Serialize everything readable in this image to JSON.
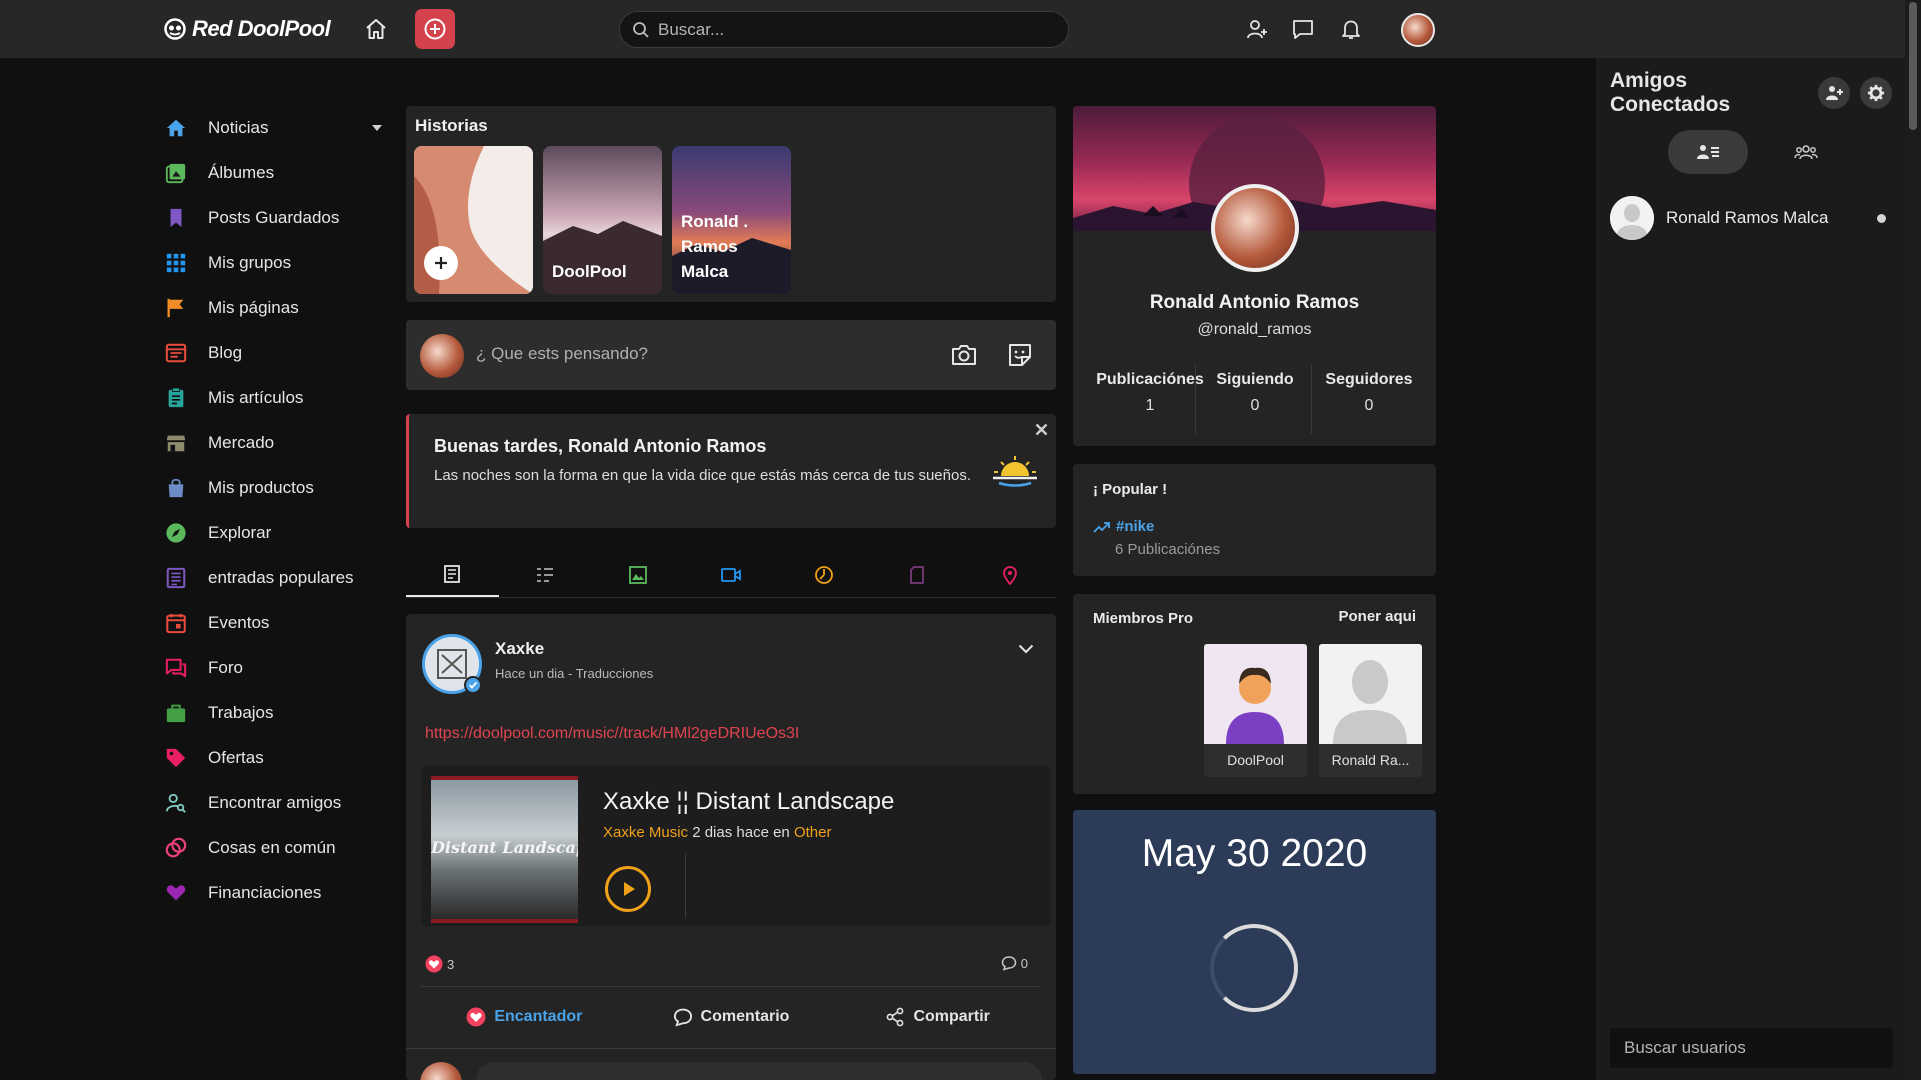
{
  "header": {
    "brand": "Red DoolPool",
    "search_placeholder": "Buscar..."
  },
  "sidebar": {
    "items": [
      {
        "label": "Noticias",
        "icon": "home-icon",
        "color": "#4aa3e8"
      },
      {
        "label": "Álbumes",
        "icon": "albums-icon",
        "color": "#5cb85c"
      },
      {
        "label": "Posts Guardados",
        "icon": "bookmark-icon",
        "color": "#7e57c2"
      },
      {
        "label": "Mis grupos",
        "icon": "groups-icon",
        "color": "#2196f3"
      },
      {
        "label": "Mis páginas",
        "icon": "flag-icon",
        "color": "#f28c28"
      },
      {
        "label": "Blog",
        "icon": "blog-icon",
        "color": "#e74c3c"
      },
      {
        "label": "Mis artículos",
        "icon": "clipboard-icon",
        "color": "#26a69a"
      },
      {
        "label": "Mercado",
        "icon": "store-icon",
        "color": "#8d8d6e"
      },
      {
        "label": "Mis productos",
        "icon": "shopping-bag-icon",
        "color": "#6b8cc7"
      },
      {
        "label": "Explorar",
        "icon": "compass-icon",
        "color": "#5cb85c"
      },
      {
        "label": "entradas populares",
        "icon": "list-icon",
        "color": "#7e57c2"
      },
      {
        "label": "Eventos",
        "icon": "calendar-icon",
        "color": "#e74c3c"
      },
      {
        "label": "Foro",
        "icon": "forum-icon",
        "color": "#e91e63"
      },
      {
        "label": "Trabajos",
        "icon": "briefcase-icon",
        "color": "#43a047"
      },
      {
        "label": "Ofertas",
        "icon": "tag-icon",
        "color": "#e91e63"
      },
      {
        "label": "Encontrar amigos",
        "icon": "find-friends-icon",
        "color": "#80cbc4"
      },
      {
        "label": "Cosas en común",
        "icon": "common-icon",
        "color": "#ec407a"
      },
      {
        "label": "Financiaciones",
        "icon": "heart-hands-icon",
        "color": "#9c27b0"
      }
    ]
  },
  "stories": {
    "title": "Historias",
    "items": [
      {
        "label": ""
      },
      {
        "label": "DoolPool"
      },
      {
        "label": "Ronald . Ramos Malca"
      }
    ]
  },
  "composer": {
    "placeholder": "¿ Que ests pensando?"
  },
  "greeting": {
    "title": "Buenas tardes, Ronald Antonio Ramos",
    "text": "Las noches son la forma en que la vida dice que estás más cerca de tus sueños."
  },
  "post": {
    "author": "Xaxke",
    "meta": "Hace un dia - Traducciones",
    "link": "https://doolpool.com/music//track/HMl2geDRIUeOs3I",
    "music": {
      "title": "Xaxke ¦¦ Distant Landscape",
      "artist": "Xaxke Music",
      "time": "2 dias hace en",
      "category": "Other",
      "cover_title": "Distant Landscape"
    },
    "reactions": "3",
    "comments": "0",
    "actions": {
      "love": "Encantador",
      "comment": "Comentario",
      "share": "Compartir"
    }
  },
  "profile": {
    "name": "Ronald Antonio Ramos",
    "handle": "@ronald_ramos",
    "stats": [
      {
        "label": "Publicaciónes",
        "value": "1"
      },
      {
        "label": "Siguiendo",
        "value": "0"
      },
      {
        "label": "Seguidores",
        "value": "0"
      }
    ]
  },
  "popular": {
    "title": "¡ Popular !",
    "tag": "#nike",
    "count": "6 Publicaciónes"
  },
  "pro_members": {
    "title": "Miembros Pro",
    "link": "Poner aqui",
    "members": [
      {
        "name": "DoolPool"
      },
      {
        "name": "Ronald Ra..."
      }
    ]
  },
  "date_widget": {
    "date": "May 30 2020"
  },
  "friends_panel": {
    "title": "Amigos Conectados",
    "friends": [
      {
        "name": "Ronald Ramos Malca"
      }
    ],
    "search_placeholder": "Buscar usuarios"
  }
}
